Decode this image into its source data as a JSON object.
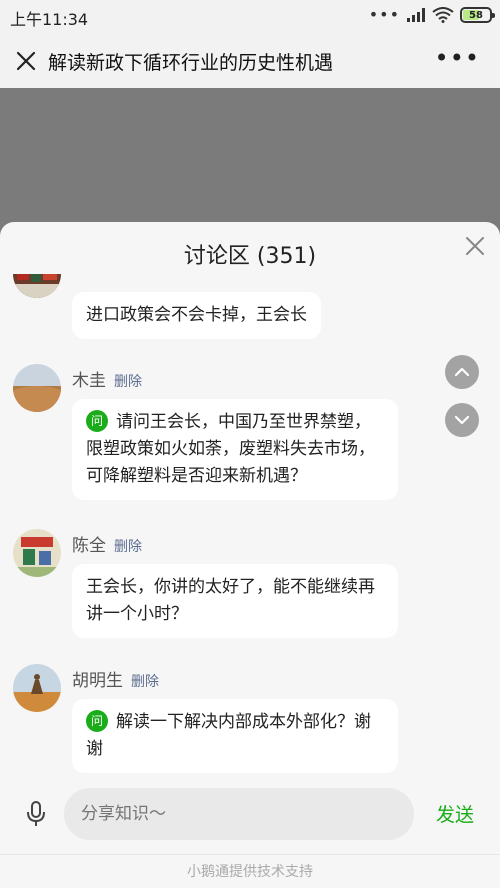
{
  "status_bar": {
    "time": "上午11:34",
    "battery": "58",
    "battery_level": 0.58
  },
  "titlebar": {
    "title": "解读新政下循环行业的历史性机遇"
  },
  "discussion": {
    "title": "讨论区 (351)",
    "messages": [
      {
        "name": "",
        "delete_label": "",
        "text": "进口政策会不会卡掉，王会长",
        "question": false
      },
      {
        "name": "木圭",
        "delete_label": "删除",
        "text": "请问王会长，中国乃至世界禁塑，限塑政策如火如荼，废塑料失去市场，可降解塑料是否迎来新机遇？",
        "question": true
      },
      {
        "name": "陈全",
        "delete_label": "删除",
        "text": "王会长，你讲的太好了，能不能继续再讲一个小时？",
        "question": false
      },
      {
        "name": "胡明生",
        "delete_label": "删除",
        "text": "解读一下解决内部成本外部化？谢谢",
        "question": true
      }
    ],
    "question_badge": "问"
  },
  "input": {
    "placeholder": "分享知识～",
    "send_label": "发送"
  },
  "footer": {
    "text": "小鹅通提供技术支持"
  },
  "colors": {
    "accent": "#1aad19",
    "delete_link": "#5b6d8f"
  }
}
